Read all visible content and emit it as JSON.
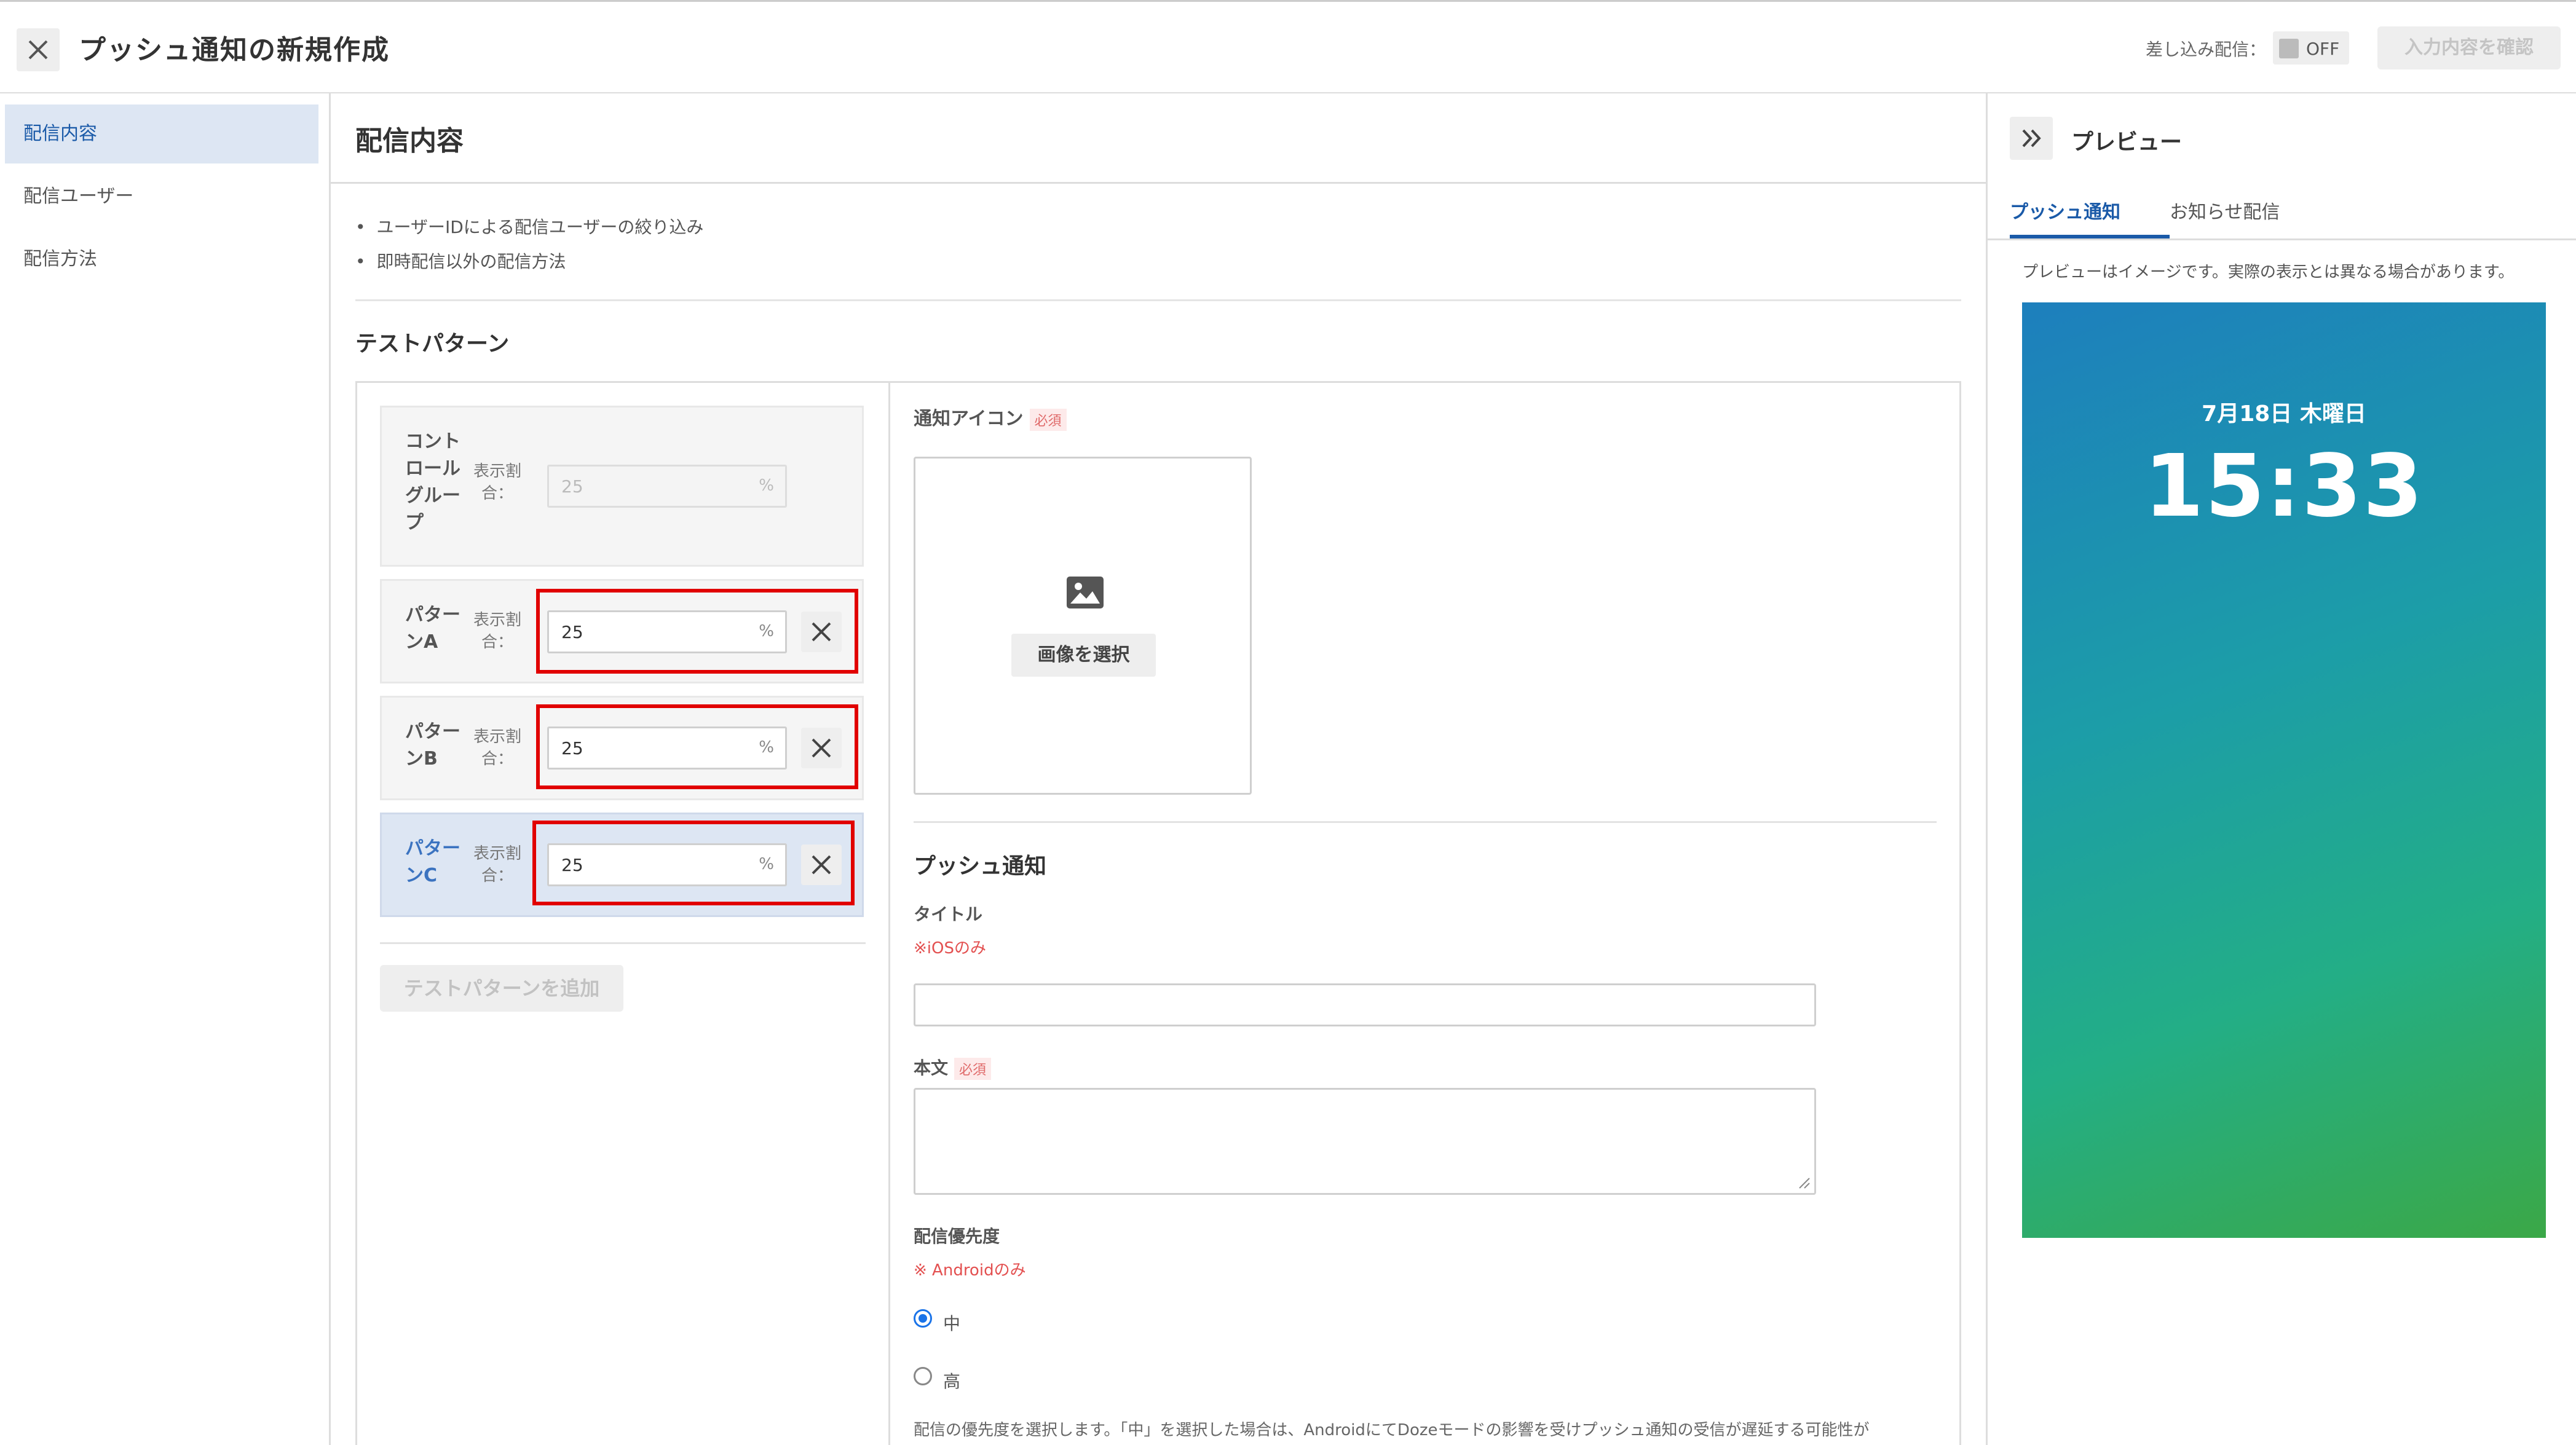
{
  "header": {
    "title": "プッシュ通知の新規作成",
    "merge_label": "差し込み配信：",
    "merge_toggle": "OFF",
    "confirm_label": "入力内容を確認"
  },
  "sidebar": {
    "items": [
      {
        "label": "配信内容"
      },
      {
        "label": "配信ユーザー"
      },
      {
        "label": "配信方法"
      }
    ]
  },
  "main": {
    "title": "配信内容",
    "bullets": [
      "ユーザーIDによる配信ユーザーの絞り込み",
      "即時配信以外の配信方法"
    ],
    "test_pattern_heading": "テストパターン",
    "ratio_label": "表示割合：",
    "unit": "%",
    "patterns": [
      {
        "name": "コントロールグループ",
        "value": "25"
      },
      {
        "name": "パターンA",
        "value": "25"
      },
      {
        "name": "パターンB",
        "value": "25"
      },
      {
        "name": "パターンC",
        "value": "25"
      }
    ],
    "add_pattern_label": "テストパターンを追加"
  },
  "form": {
    "icon_label": "通知アイコン",
    "required": "必須",
    "select_image": "画像を選択",
    "push_heading": "プッシュ通知",
    "title_label": "タイトル",
    "title_note": "※iOSのみ",
    "body_label": "本文",
    "priority_label": "配信優先度",
    "priority_note": "※ Androidのみ",
    "priority_options": [
      {
        "label": "中",
        "selected": true
      },
      {
        "label": "高",
        "selected": false
      }
    ],
    "priority_desc": "配信の優先度を選択します。「中」を選択した場合は、AndroidにてDozeモードの影響を受けプッシュ通知の受信が遅延する可能性が"
  },
  "preview": {
    "title": "プレビュー",
    "tabs": [
      {
        "label": "プッシュ通知",
        "active": true
      },
      {
        "label": "お知らせ配信",
        "active": false
      }
    ],
    "note": "プレビューはイメージです。実際の表示とは異なる場合があります。",
    "date": "7月18日 木曜日",
    "time": "15:33"
  },
  "colors": {
    "accent": "#1a5aa8",
    "highlight_border": "#e10000",
    "required_badge": "#e06a6a",
    "preview_gradient_top": "#1d7fbd",
    "preview_gradient_bottom": "#3ba847"
  }
}
